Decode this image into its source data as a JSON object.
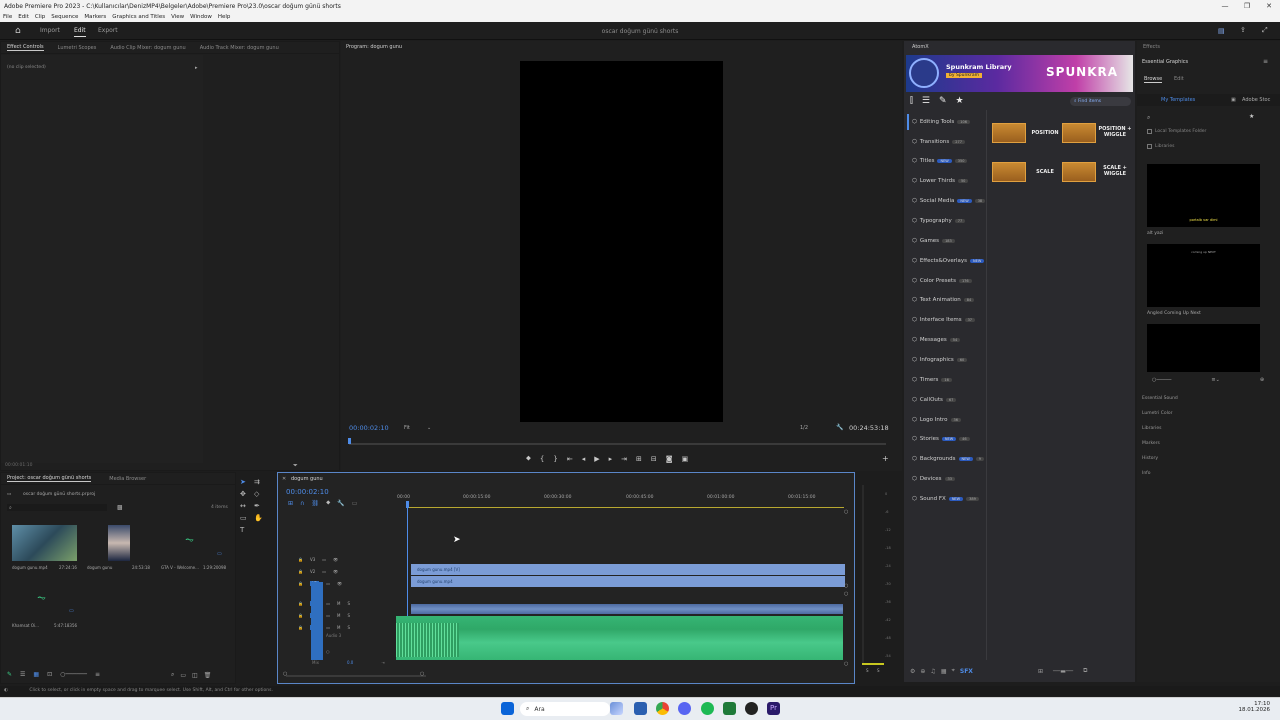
{
  "window": {
    "title": "Adobe Premiere Pro 2023 - C:\\Kullanıcılar\\DenizMP4\\Belgeler\\Adobe\\Premiere Pro\\23.0\\oscar doğum günü shorts",
    "controls": [
      "—",
      "❐",
      "✕"
    ]
  },
  "menu": [
    "File",
    "Edit",
    "Clip",
    "Sequence",
    "Markers",
    "Graphics and Titles",
    "View",
    "Window",
    "Help"
  ],
  "workspace": {
    "tabs": [
      "Import",
      "Edit",
      "Export"
    ],
    "active": "Edit",
    "project_title": "oscar doğum günü shorts"
  },
  "source_panel": {
    "tabs": [
      "Effect Controls",
      "Lumetri Scopes",
      "Audio Clip Mixer: dogum gunu",
      "Audio Track Mixer: dogum gunu"
    ],
    "no_clip": "(no clip selected)",
    "timecode": "00:00:01:10"
  },
  "program_monitor": {
    "tab": "Program: dogum gunu",
    "timecode": "00:00:02:10",
    "fit": "Fit",
    "quality": "1/2",
    "duration": "00:24:53:18"
  },
  "project_panel": {
    "tabs": [
      "Project: oscar doğum günü shorts",
      "Media Browser"
    ],
    "file": "oscar doğum günü shorts.prproj",
    "item_count": "4 items",
    "items": [
      {
        "name": "dogum gunu.mp4",
        "dur": "27:24:16"
      },
      {
        "name": "dogum gunu",
        "dur": "24:53:18"
      },
      {
        "name": "GTA V - Welcome...",
        "dur": "1:29:20098"
      },
      {
        "name": "Khamsat Oi...",
        "dur": "5:47:18356"
      }
    ]
  },
  "timeline": {
    "tab": "dogum gunu",
    "timecode": "00:00:02:10",
    "ruler": [
      "00:00",
      "00:00:15:00",
      "00:00:30:00",
      "00:00:45:00",
      "00:01:00:00",
      "00:01:15:00"
    ],
    "tracks": [
      "V3",
      "V2",
      "V1",
      "A1",
      "A2",
      "A3"
    ],
    "audio3_label": "Audio 3",
    "mix_label": "Mix",
    "clip_v2": "dogum gunu.mp4 [V]",
    "clip_v1": "dogum gunu.mp4",
    "meter_scale": [
      "0",
      "-6",
      "-12",
      "-18",
      "-24",
      "-30",
      "-36",
      "-42",
      "-48",
      "-54"
    ],
    "meter_sides": [
      "S",
      "S"
    ]
  },
  "atomx": {
    "tab": "AtomX",
    "banner_title": "Spunkram Library",
    "banner_sub": "by Spunkram",
    "banner_brand": "SPUNKRA",
    "search_placeholder": "Find items",
    "categories": [
      {
        "label": "Editing Tools",
        "badge": "106"
      },
      {
        "label": "Transitions",
        "badge": "277"
      },
      {
        "label": "Titles",
        "badge": "350",
        "new": "NEW"
      },
      {
        "label": "Lower Thirds",
        "badge": "50"
      },
      {
        "label": "Social Media",
        "badge": "38",
        "new": "NEW"
      },
      {
        "label": "Typography",
        "badge": "77"
      },
      {
        "label": "Games",
        "badge": "183"
      },
      {
        "label": "Effects&Overlays",
        "new": "NEW"
      },
      {
        "label": "Color Presets",
        "badge": "176"
      },
      {
        "label": "Text Animation",
        "badge": "84"
      },
      {
        "label": "Interface Items",
        "badge": "37"
      },
      {
        "label": "Messages",
        "badge": "54"
      },
      {
        "label": "Infographics",
        "badge": "60"
      },
      {
        "label": "Timers",
        "badge": "16"
      },
      {
        "label": "CallOuts",
        "badge": "67"
      },
      {
        "label": "Logo Intro",
        "badge": "36"
      },
      {
        "label": "Stories",
        "badge": "46",
        "new": "NEW"
      },
      {
        "label": "Backgrounds",
        "badge": "9",
        "new": "NEW"
      },
      {
        "label": "Devices",
        "badge": "33"
      },
      {
        "label": "Sound FX",
        "badge": "389",
        "new": "NEW"
      }
    ],
    "presets": [
      "POSITION",
      "POSITION + WIGGLE",
      "SCALE",
      "SCALE + WIGGLE"
    ]
  },
  "right_panel": {
    "effects_tab": "Effects",
    "eg_title": "Essential Graphics",
    "tabs": [
      "Browse",
      "Edit"
    ],
    "sub_tabs": [
      "My Templates",
      "Adobe Stoc"
    ],
    "checkboxes": [
      "Local Templates Folder",
      "Libraries"
    ],
    "templates": [
      {
        "title": "alt yazi",
        "preview_text": "portalb var dimi"
      },
      {
        "title": "Angled Coming Up Next",
        "preview_text": "coming up NEXT"
      }
    ],
    "sections": [
      "Essential Sound",
      "Lumetri Color",
      "Libraries",
      "Markers",
      "History",
      "Info"
    ]
  },
  "status_text": "Click to select, or click in empty space and drag to marquee select. Use Shift, Alt, and Ctrl for other options.",
  "taskbar": {
    "search": "Ara",
    "time": "17:10",
    "date": "18.01.2026"
  }
}
